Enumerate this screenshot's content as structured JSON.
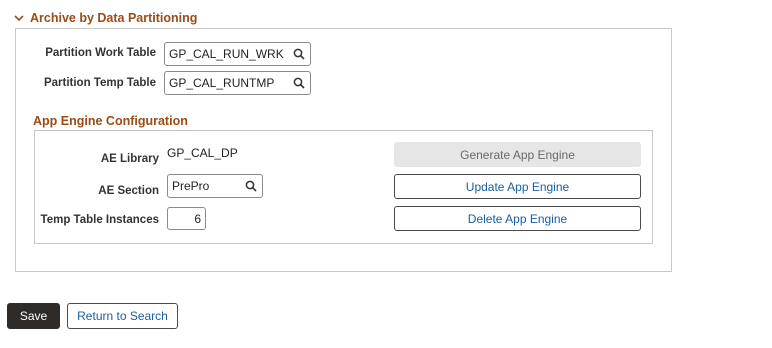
{
  "section": {
    "title": "Archive by Data Partitioning",
    "partition_work_table": {
      "label": "Partition Work Table",
      "value": "GP_CAL_RUN_WRK"
    },
    "partition_temp_table": {
      "label": "Partition Temp Table",
      "value": "GP_CAL_RUNTMP"
    }
  },
  "app_engine": {
    "title": "App Engine Configuration",
    "ae_library": {
      "label": "AE Library",
      "value": "GP_CAL_DP"
    },
    "ae_section": {
      "label": "AE Section",
      "value": "PrePro"
    },
    "temp_table_instances": {
      "label": "Temp Table Instances",
      "value": "6"
    },
    "buttons": {
      "generate": "Generate App Engine",
      "update": "Update App Engine",
      "delete": "Delete App Engine"
    }
  },
  "footer": {
    "save": "Save",
    "return_to_search": "Return to Search"
  },
  "icons": {
    "collapse": "chevron-down-icon",
    "lookup": "search-icon"
  },
  "colors": {
    "section_title": "#9a4c17",
    "link_blue": "#1a5fa3",
    "primary_button": "#2e2b28"
  }
}
